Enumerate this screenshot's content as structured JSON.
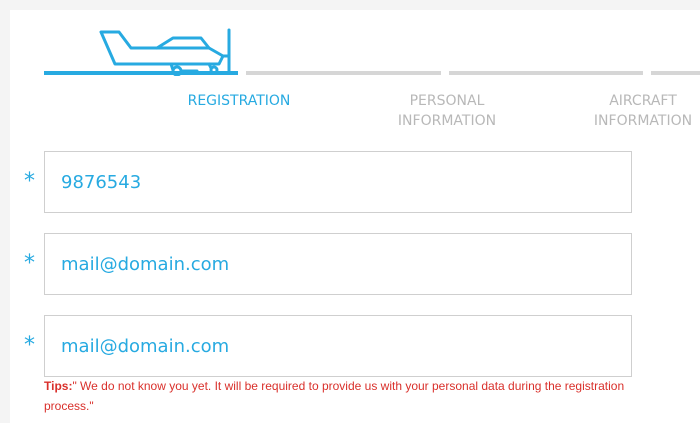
{
  "steps": [
    {
      "label": "REGISTRATION",
      "active": true
    },
    {
      "label": "PERSONAL\nINFORMATION",
      "active": false
    },
    {
      "label": "AIRCRAFT\nINFORMATION",
      "active": false
    }
  ],
  "form": {
    "phone_value": "9876543",
    "email_value": "mail@domain.com",
    "email_confirm_value": "mail@domain.com",
    "required_mark": "*"
  },
  "tips": {
    "label": "Tips:",
    "text": "\" We do not know you yet. It will be required to provide us with your personal data during the registration process.\""
  },
  "colors": {
    "accent": "#27aae1",
    "inactive": "#b8b8b8",
    "track": "#d6d6d6",
    "tips": "#d9302b"
  },
  "icons": {
    "plane": "plane-icon"
  }
}
